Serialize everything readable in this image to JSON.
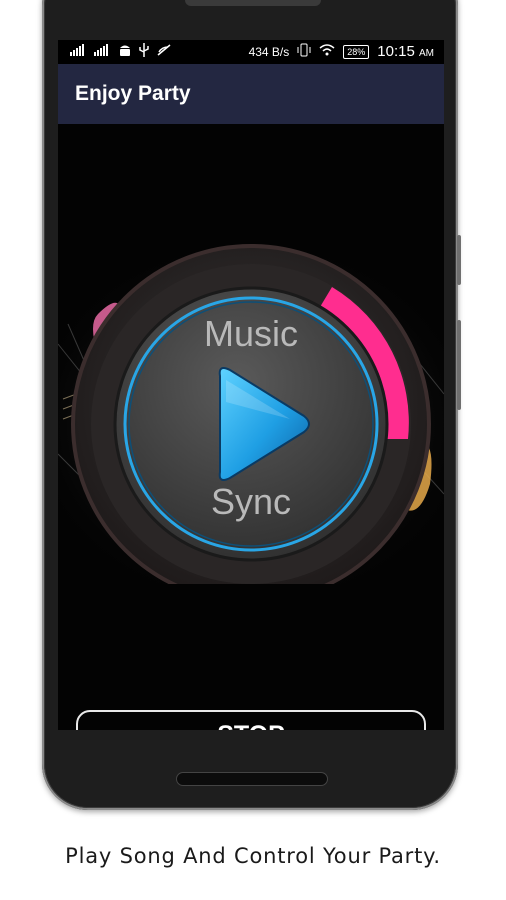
{
  "statusbar": {
    "signal1": "▐░▐",
    "net_speed": "434 B/s",
    "battery": "28%",
    "time": "10:15",
    "ampm": "AM"
  },
  "app": {
    "title": "Enjoy Party"
  },
  "player": {
    "label_top": "Music",
    "label_bottom": "Sync",
    "state": "play"
  },
  "controls": {
    "stop_label": "STOP"
  },
  "caption": "Play Song And Control Your Party.",
  "colors": {
    "appbar": "#232741",
    "accent_blue": "#29a6e6",
    "accent_pink": "#ff2d8f",
    "screen_bg": "#030303"
  }
}
